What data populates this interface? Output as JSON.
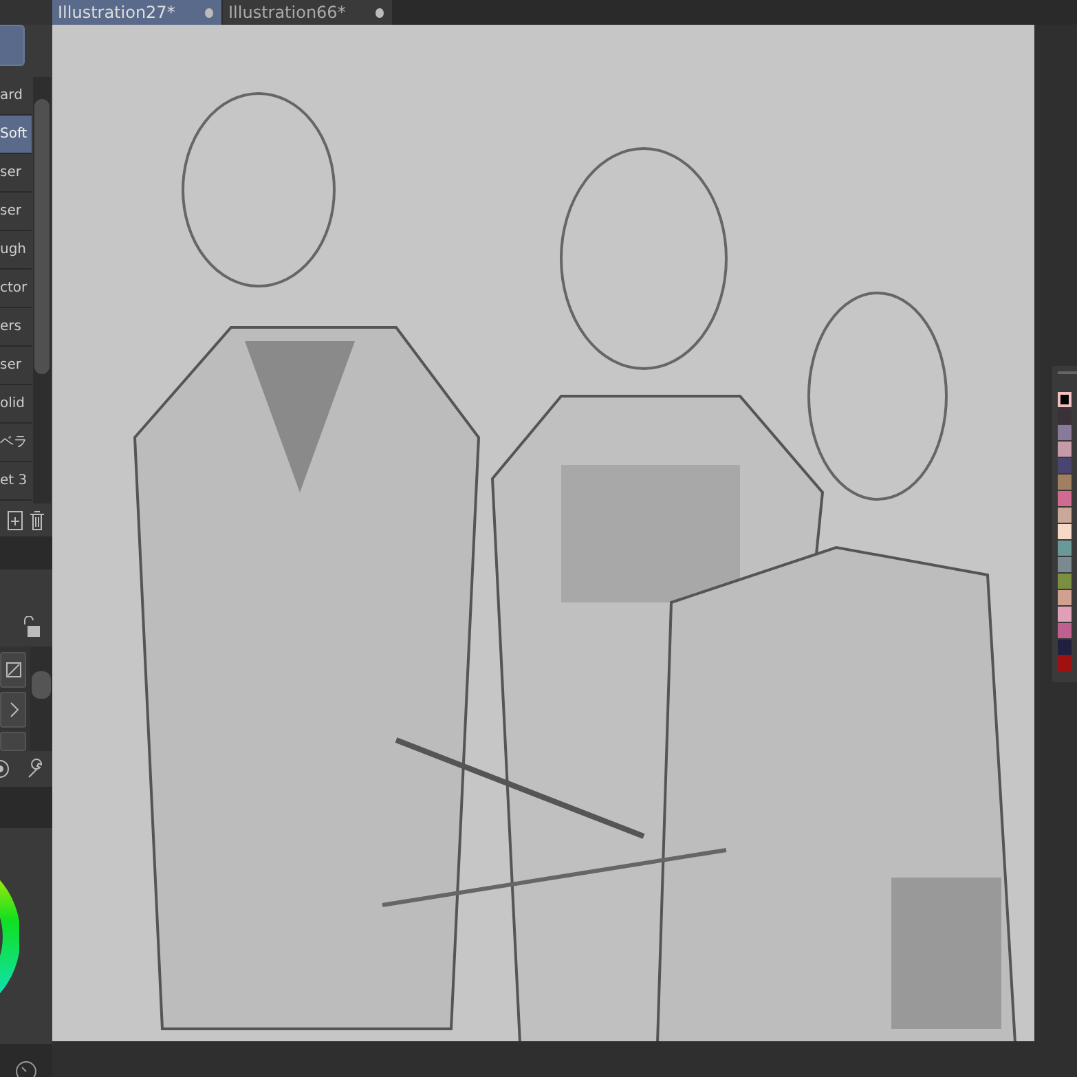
{
  "tabs": [
    {
      "label": "Illustration27*",
      "selected": true
    },
    {
      "label": "Illustration66*",
      "selected": false
    }
  ],
  "brushes": [
    {
      "label": "ard",
      "selected": false
    },
    {
      "label": "Soft",
      "selected": true
    },
    {
      "label": "ser",
      "selected": false
    },
    {
      "label": "ser",
      "selected": false
    },
    {
      "label": "ugh",
      "selected": false
    },
    {
      "label": "ctor",
      "selected": false
    },
    {
      "label": "ers",
      "selected": false
    },
    {
      "label": "ser",
      "selected": false
    },
    {
      "label": "olid",
      "selected": false
    },
    {
      "label": "ベラ",
      "selected": false
    },
    {
      "label": "et 3",
      "selected": false
    }
  ],
  "palette": [
    {
      "color": "#000000",
      "selected": true
    },
    {
      "color": "#3a3238",
      "selected": false
    },
    {
      "color": "#8a7a9a",
      "selected": false
    },
    {
      "color": "#c79aa8",
      "selected": false
    },
    {
      "color": "#4a4470",
      "selected": false
    },
    {
      "color": "#a08060",
      "selected": false
    },
    {
      "color": "#d06a90",
      "selected": false
    },
    {
      "color": "#c8a898",
      "selected": false
    },
    {
      "color": "#f6d8c8",
      "selected": false
    },
    {
      "color": "#6a9a98",
      "selected": false
    },
    {
      "color": "#7a8a90",
      "selected": false
    },
    {
      "color": "#7a9040",
      "selected": false
    },
    {
      "color": "#d0a090",
      "selected": false
    },
    {
      "color": "#e0a0b8",
      "selected": false
    },
    {
      "color": "#c06090",
      "selected": false
    },
    {
      "color": "#202040",
      "selected": false
    },
    {
      "color": "#a01010",
      "selected": false
    }
  ]
}
